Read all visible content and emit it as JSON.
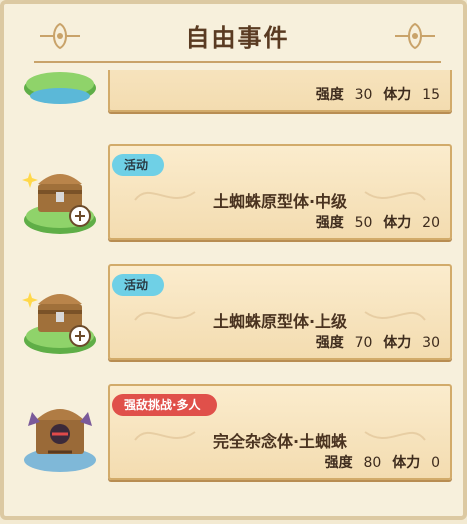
{
  "header": {
    "title": "自由事件"
  },
  "rows": [
    {
      "tag": "",
      "name": "",
      "strength_label": "强度",
      "strength": "30",
      "stamina_label": "体力",
      "stamina": "15"
    },
    {
      "tag": "活动",
      "name": "土蜘蛛原型体·中级",
      "strength_label": "强度",
      "strength": "50",
      "stamina_label": "体力",
      "stamina": "20"
    },
    {
      "tag": "活动",
      "name": "土蜘蛛原型体·上级",
      "strength_label": "强度",
      "strength": "70",
      "stamina_label": "体力",
      "stamina": "30"
    },
    {
      "tag": "强敌挑战·多人",
      "name": "完全杂念体·土蜘蛛",
      "strength_label": "强度",
      "strength": "80",
      "stamina_label": "体力",
      "stamina": "0"
    }
  ]
}
